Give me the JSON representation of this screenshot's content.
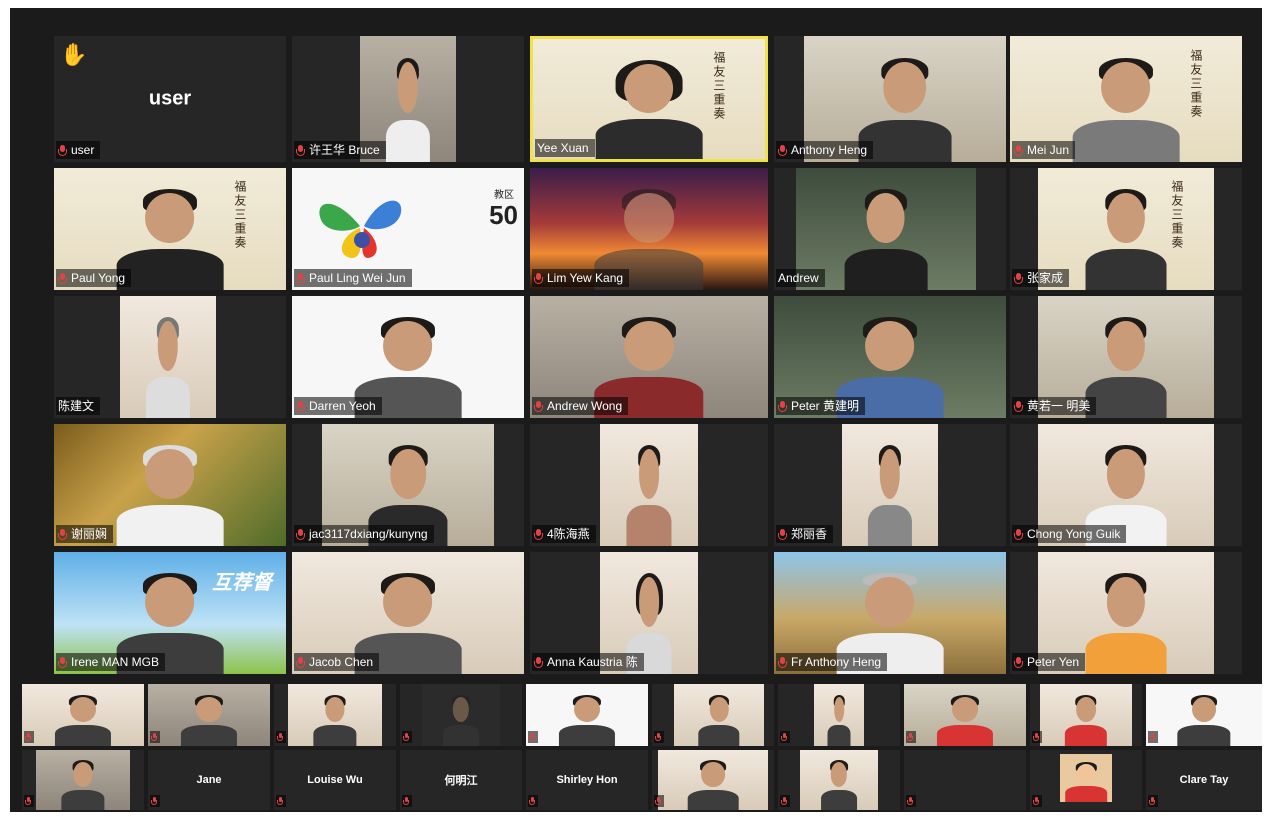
{
  "meeting": {
    "main_grid": [
      {
        "name": "user",
        "label": "user",
        "muted": true,
        "video": false,
        "hand_raised": true
      },
      {
        "name": "许王华 Bruce",
        "muted": true,
        "video": true
      },
      {
        "name": "Yee Xuan",
        "muted": false,
        "video": true,
        "active_speaker": true,
        "poster_text": "福友三重奏"
      },
      {
        "name": "Anthony Heng",
        "muted": true,
        "video": true
      },
      {
        "name": "Mei Jun",
        "muted": true,
        "video": true,
        "poster_text": "福友三重奏"
      },
      {
        "name": "Paul Yong",
        "muted": true,
        "video": true,
        "poster_text": "福友三重奏"
      },
      {
        "name": "Paul Ling Wei Jun",
        "muted": true,
        "video": true,
        "badge_text": "50",
        "badge_top": "教区"
      },
      {
        "name": "Lim Yew Kang",
        "muted": true,
        "video": true
      },
      {
        "name": "Andrew",
        "muted": false,
        "video": true
      },
      {
        "name": "张家成",
        "muted": true,
        "video": true,
        "poster_text": "福友三重奏"
      },
      {
        "name": "陈建文",
        "muted": false,
        "video": true
      },
      {
        "name": "Darren Yeoh",
        "muted": true,
        "video": true
      },
      {
        "name": "Andrew Wong",
        "muted": true,
        "video": true
      },
      {
        "name": "Peter 黄建明",
        "muted": true,
        "video": true
      },
      {
        "name": "黄若一 明美",
        "muted": true,
        "video": true
      },
      {
        "name": "谢丽娴",
        "muted": true,
        "video": true
      },
      {
        "name": "jac3117dxiang/kunyng",
        "muted": true,
        "video": true
      },
      {
        "name": "4陈海燕",
        "muted": true,
        "video": true
      },
      {
        "name": "郑丽香",
        "muted": true,
        "video": true
      },
      {
        "name": "Chong Yong Guik",
        "muted": true,
        "video": true
      },
      {
        "name": "Irene MAN MGB",
        "muted": true,
        "video": true,
        "background_text": "互荐督"
      },
      {
        "name": "Jacob Chen",
        "muted": true,
        "video": true
      },
      {
        "name": "Anna Kaustria 陈",
        "muted": true,
        "video": true
      },
      {
        "name": "Fr Anthony Heng",
        "muted": true,
        "video": true
      },
      {
        "name": "Peter Yen",
        "muted": true,
        "video": true
      }
    ],
    "strip_row_1": [
      {
        "name": "",
        "video": true
      },
      {
        "name": "",
        "video": true
      },
      {
        "name": "",
        "video": true
      },
      {
        "name": "",
        "video": true
      },
      {
        "name": "",
        "video": true
      },
      {
        "name": "",
        "video": true
      },
      {
        "name": "",
        "video": true
      },
      {
        "name": "",
        "video": true
      },
      {
        "name": "",
        "video": true
      },
      {
        "name": "",
        "video": true
      }
    ],
    "strip_row_2": [
      {
        "name": "",
        "video": true
      },
      {
        "name": "Jane",
        "label": "Jane",
        "video": false
      },
      {
        "name": "Louise Wu",
        "label": "Louise Wu",
        "video": false
      },
      {
        "name": "何明江",
        "label": "何明江",
        "video": false
      },
      {
        "name": "Shirley Hon",
        "label": "Shirley Hon",
        "video": false
      },
      {
        "name": "",
        "video": true
      },
      {
        "name": "",
        "video": true
      },
      {
        "name": "",
        "video": false
      },
      {
        "name": "",
        "video": true
      },
      {
        "name": "Clare Tay",
        "label": "Clare Tay",
        "video": false
      }
    ],
    "colors": {
      "background": "#1b1b1b",
      "tile": "#262626",
      "active_speaker_border": "#f2e24a",
      "muted_icon": "#e04343",
      "name_text": "#ffffff"
    }
  }
}
